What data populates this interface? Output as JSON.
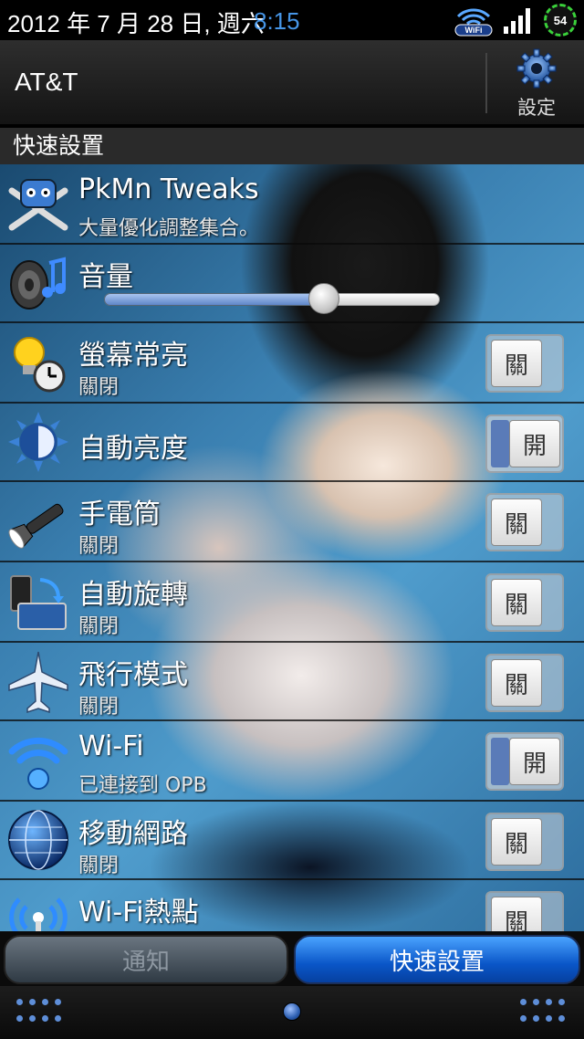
{
  "status_bar": {
    "date": "2012 年 7 月 28 日, 週六",
    "time": "8:15",
    "wifi_label": "WiFi",
    "battery": "54"
  },
  "header": {
    "carrier": "AT&T",
    "settings_label": "設定"
  },
  "section_title": "快速設置",
  "items": [
    {
      "title": "PkMn Tweaks",
      "subtitle": "大量優化調整集合。",
      "icon": "crossed-bones-robot-icon"
    },
    {
      "title": "音量",
      "icon": "speaker-icon",
      "slider_level": 0.67
    },
    {
      "title": "螢幕常亮",
      "subtitle": "關閉",
      "toggle": "關",
      "toggle_on": false,
      "icon": "bulb-clock-icon"
    },
    {
      "title": "自動亮度",
      "toggle": "開",
      "toggle_on": true,
      "icon": "sun-icon"
    },
    {
      "title": "手電筒",
      "subtitle": "關閉",
      "toggle": "關",
      "toggle_on": false,
      "icon": "flashlight-icon"
    },
    {
      "title": "自動旋轉",
      "subtitle": "關閉",
      "toggle": "關",
      "toggle_on": false,
      "icon": "rotate-screen-icon"
    },
    {
      "title": "飛行模式",
      "subtitle": "關閉",
      "toggle": "關",
      "toggle_on": false,
      "icon": "airplane-icon"
    },
    {
      "title": "Wi-Fi",
      "subtitle": "已連接到 OPB",
      "toggle": "開",
      "toggle_on": true,
      "icon": "wifi-icon"
    },
    {
      "title": "移動網路",
      "subtitle": "關閉",
      "toggle": "關",
      "toggle_on": false,
      "icon": "globe-icon"
    },
    {
      "title": "Wi-Fi熱點",
      "toggle": "關",
      "toggle_on": false,
      "icon": "hotspot-icon"
    }
  ],
  "tabs": {
    "notifications": "通知",
    "quick_settings": "快速設置"
  },
  "colors": {
    "accent_blue": "#0a56c8",
    "toggle_on_fill": "#5a7bb8",
    "battery_ring": "#3ad13a"
  }
}
